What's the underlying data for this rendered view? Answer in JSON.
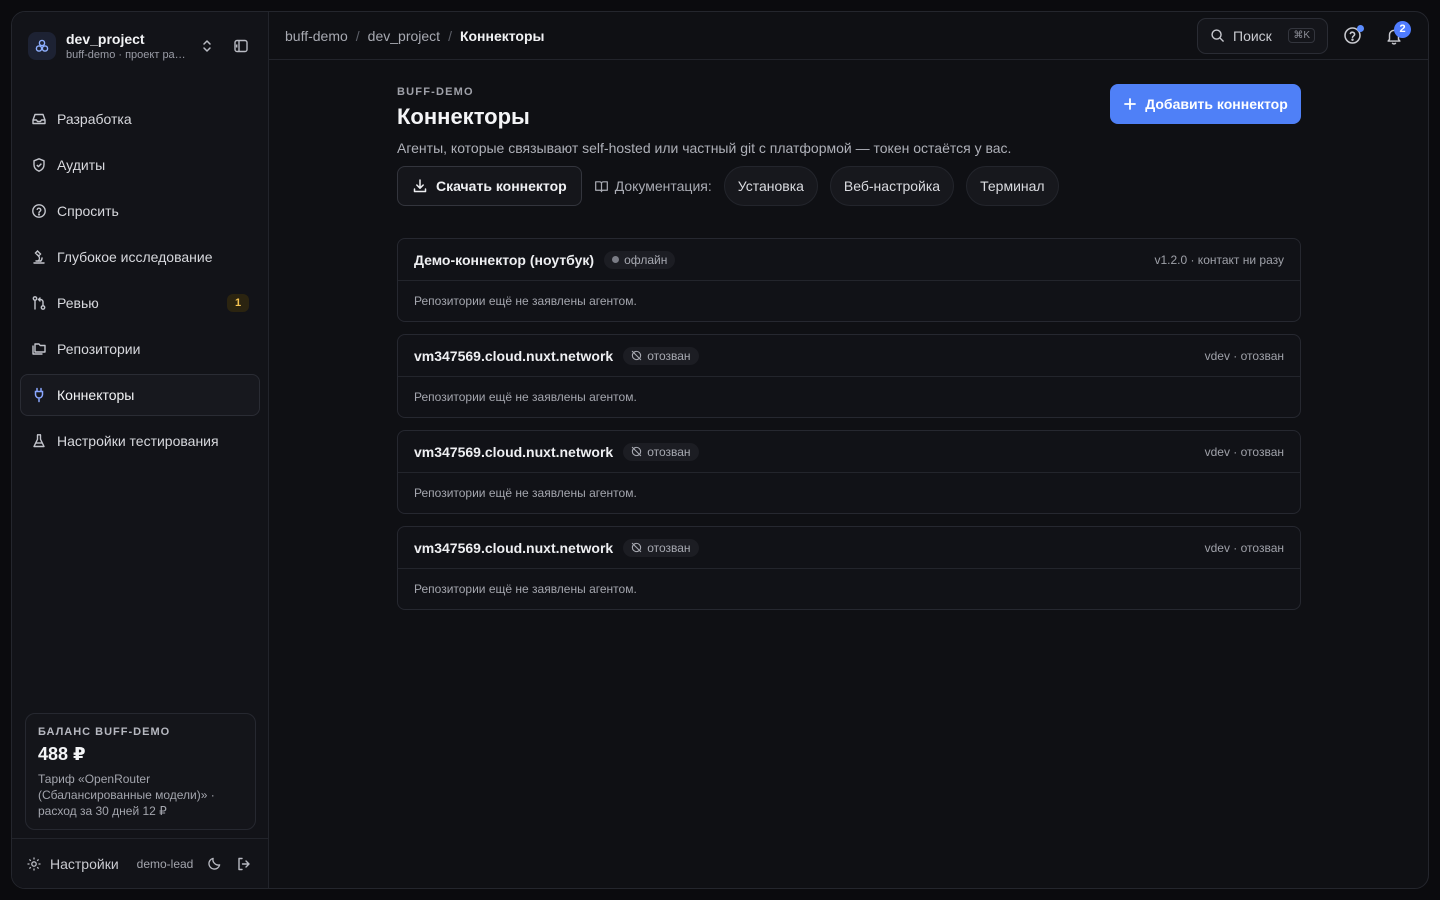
{
  "colors": {
    "accent": "#4f80f7",
    "badge": "#f5c451",
    "notif": "#4f7cff"
  },
  "project": {
    "name": "dev_project",
    "subtitle": "buff-demo · проект разр..."
  },
  "sidebar": {
    "items": [
      {
        "label": "Разработка",
        "icon": "inbox-icon"
      },
      {
        "label": "Аудиты",
        "icon": "shield-icon"
      },
      {
        "label": "Спросить",
        "icon": "question-icon"
      },
      {
        "label": "Глубокое исследование",
        "icon": "microscope-icon"
      },
      {
        "label": "Ревью",
        "icon": "git-compare-icon",
        "badge": "1"
      },
      {
        "label": "Репозитории",
        "icon": "repo-icon"
      },
      {
        "label": "Коннекторы",
        "icon": "plug-icon",
        "active": true
      },
      {
        "label": "Настройки тестирования",
        "icon": "flask-icon"
      }
    ]
  },
  "balance": {
    "title": "БАЛАНС BUFF-DEMO",
    "amount": "488 ₽",
    "description": "Тариф «OpenRouter (Сбалансированные модели)» · расход за 30 дней 12 ₽"
  },
  "footer": {
    "settings_label": "Настройки",
    "user": "demo-lead"
  },
  "topbar": {
    "breadcrumbs": [
      "buff-demo",
      "dev_project",
      "Коннекторы"
    ],
    "search_label": "Поиск",
    "search_shortcut": "⌘K",
    "notifications_count": "2"
  },
  "page": {
    "eyebrow": "BUFF-DEMO",
    "title": "Коннекторы",
    "description": "Агенты, которые связывают self-hosted или частный git с платформой — токен остаётся у вас.",
    "add_button": "Добавить коннектор",
    "download_button": "Скачать коннектор",
    "docs_label": "Документация:",
    "doc_links": [
      "Установка",
      "Веб-настройка",
      "Терминал"
    ]
  },
  "connectors": [
    {
      "name": "Демо-коннектор (ноутбук)",
      "status": "офлайн",
      "status_kind": "offline",
      "meta": "v1.2.0 · контакт ни разу",
      "body": "Репозитории ещё не заявлены агентом."
    },
    {
      "name": "vm347569.cloud.nuxt.network",
      "status": "отозван",
      "status_kind": "revoked",
      "meta": "vdev · отозван",
      "body": "Репозитории ещё не заявлены агентом."
    },
    {
      "name": "vm347569.cloud.nuxt.network",
      "status": "отозван",
      "status_kind": "revoked",
      "meta": "vdev · отозван",
      "body": "Репозитории ещё не заявлены агентом."
    },
    {
      "name": "vm347569.cloud.nuxt.network",
      "status": "отозван",
      "status_kind": "revoked",
      "meta": "vdev · отозван",
      "body": "Репозитории ещё не заявлены агентом."
    }
  ]
}
